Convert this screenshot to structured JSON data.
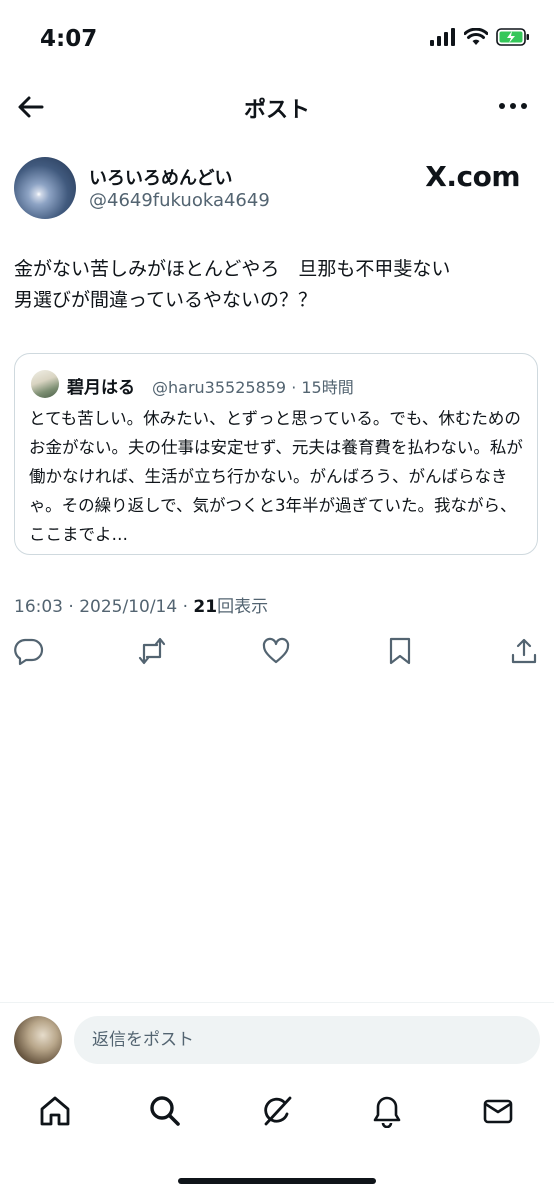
{
  "status_bar": {
    "time": "4:07"
  },
  "header": {
    "title": "ポスト"
  },
  "post": {
    "author": {
      "display_name": "いろいろめんどい",
      "handle": "@4649fukuoka4649"
    },
    "source_brand": "X.com",
    "text": "金がない苦しみがほとんどやろ　旦那も不甲斐ない\n男選びが間違っているやないの？？",
    "time": "16:03 · 2025/10/14 · ",
    "views_count": "21",
    "views_label": "回表示"
  },
  "quote": {
    "display_name": "碧月はる",
    "meta": "@haru35525859 · 15時間",
    "text": "とても苦しい。休みたい、とずっと思っている。でも、休むためのお金がない。夫の仕事は安定せず、元夫は養育費を払わない。私が働かなければ、生活が立ち行かない。がんばろう、がんばらなきゃ。その繰り返しで、気がつくと3年半が過ぎていた。我ながら、ここまでよ…"
  },
  "actions": [
    "reply-icon",
    "repost-icon",
    "like-icon",
    "bookmark-icon",
    "share-icon"
  ],
  "reply_bar": {
    "placeholder": "返信をポスト"
  },
  "tabbar": [
    "home-icon",
    "search-icon",
    "grok-icon",
    "notifications-icon",
    "messages-icon"
  ],
  "colors": {
    "text": "#0f1419",
    "secondary": "#536471",
    "border": "#cfd9de",
    "battery": "#34c759"
  }
}
